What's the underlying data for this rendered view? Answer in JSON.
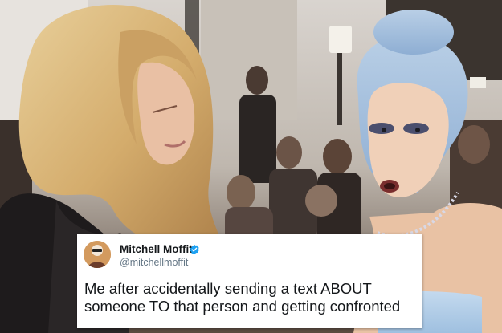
{
  "tweet": {
    "display_name": "Mitchell Moffit",
    "handle": "@mitchellmoffit",
    "verified": true,
    "verified_icon": "verified-badge-icon",
    "text": "Me after accidentally sending a text ABOUT someone TO that person and getting confronted"
  },
  "colors": {
    "verified_badge": "#1da1f2",
    "handle_text": "#657786",
    "name_text": "#14171a",
    "card_background": "#ffffff"
  }
}
